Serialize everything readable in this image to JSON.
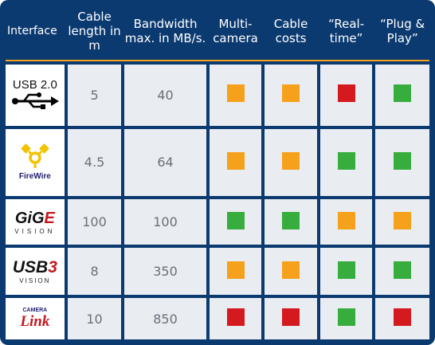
{
  "colors": {
    "header_bg": "#0b3a70",
    "separator": "#f3a11d",
    "cell_bg": "#e9ecf1",
    "orange": "#f6a11c",
    "green": "#37ad3d",
    "red": "#d4191f"
  },
  "headers": {
    "interface": "Interface",
    "cable_length": "Cable length in m",
    "bandwidth": "Bandwidth max. in MB/s.",
    "multi_camera": "Multi-camera",
    "cable_costs": "Cable costs",
    "real_time": "“Real-time”",
    "plug_play": "“Plug & Play”"
  },
  "rows": [
    {
      "interface": {
        "label": "USB 2.0",
        "icon": "usb-trident-icon"
      },
      "cable_length": "5",
      "bandwidth": "40",
      "ratings": {
        "multi_camera": "orange",
        "cable_costs": "orange",
        "real_time": "red",
        "plug_play": "green"
      }
    },
    {
      "interface": {
        "label": "FireWire",
        "icon": "firewire-icon"
      },
      "cable_length": "4.5",
      "bandwidth": "64",
      "ratings": {
        "multi_camera": "orange",
        "cable_costs": "orange",
        "real_time": "green",
        "plug_play": "green"
      }
    },
    {
      "interface": {
        "label_main": "GiG",
        "label_accent": "E",
        "label_sub": "VISION",
        "icon": "gige-vision-logo"
      },
      "cable_length": "100",
      "bandwidth": "100",
      "ratings": {
        "multi_camera": "green",
        "cable_costs": "green",
        "real_time": "orange",
        "plug_play": "orange"
      }
    },
    {
      "interface": {
        "label_main": "USB",
        "label_accent": "3",
        "label_sub": "VISION",
        "icon": "usb3-vision-logo"
      },
      "cable_length": "8",
      "bandwidth": "350",
      "ratings": {
        "multi_camera": "orange",
        "cable_costs": "orange",
        "real_time": "green",
        "plug_play": "green"
      }
    },
    {
      "interface": {
        "label_top": "CAMERA",
        "label_main": "Link",
        "icon": "camera-link-logo"
      },
      "cable_length": "10",
      "bandwidth": "850",
      "ratings": {
        "multi_camera": "red",
        "cable_costs": "red",
        "real_time": "green",
        "plug_play": "red"
      }
    }
  ]
}
